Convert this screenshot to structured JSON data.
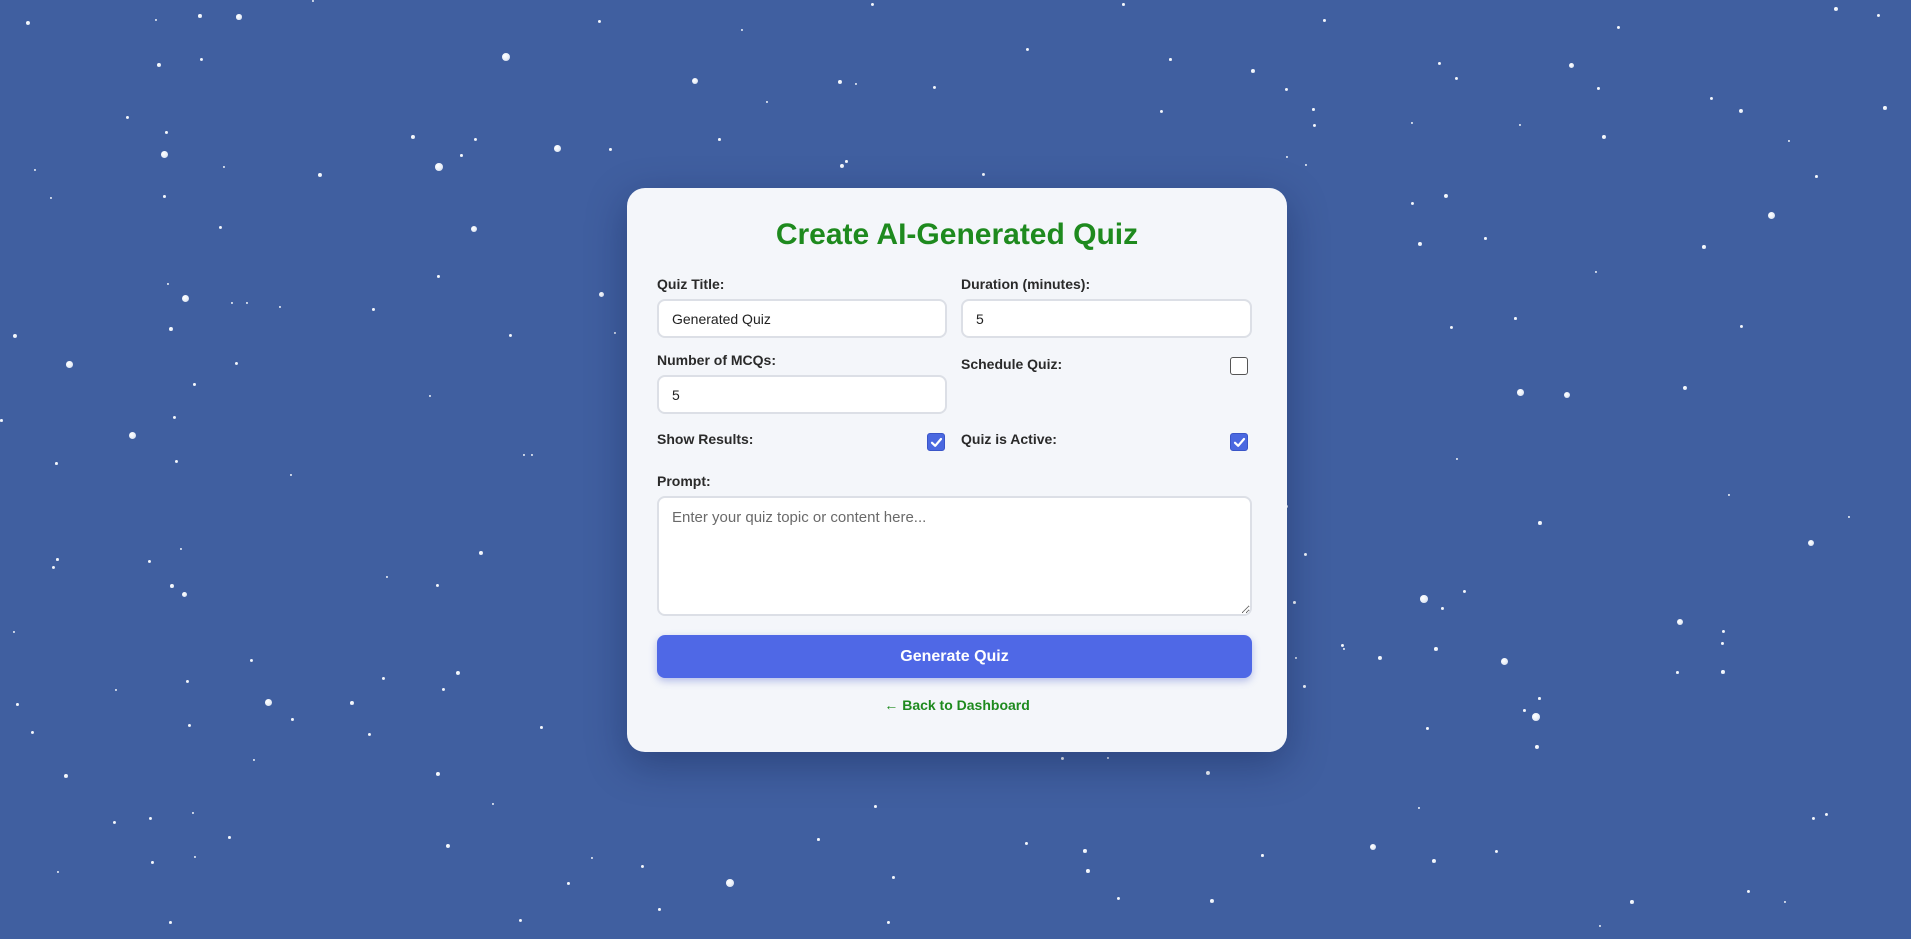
{
  "page": {
    "title": "Create AI-Generated Quiz",
    "accent_color": "#1e8a1e",
    "button_color": "#4f68e6",
    "background_color": "#405fa0"
  },
  "form": {
    "quiz_title": {
      "label": "Quiz Title:",
      "value": "Generated Quiz"
    },
    "duration": {
      "label": "Duration (minutes):",
      "value": "5"
    },
    "num_mcqs": {
      "label": "Number of MCQs:",
      "value": "5"
    },
    "schedule_quiz": {
      "label": "Schedule Quiz:",
      "checked": false
    },
    "show_results": {
      "label": "Show Results:",
      "checked": true
    },
    "quiz_active": {
      "label": "Quiz is Active:",
      "checked": true
    },
    "prompt": {
      "label": "Prompt:",
      "placeholder": "Enter your quiz topic or content here...",
      "value": ""
    },
    "submit_label": "Generate Quiz"
  },
  "nav": {
    "back_arrow": "←",
    "back_label": "Back to Dashboard"
  }
}
